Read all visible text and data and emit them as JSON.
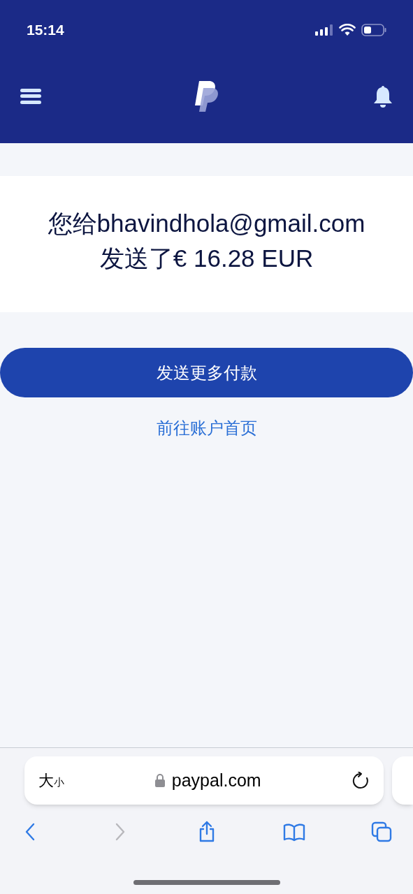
{
  "status_bar": {
    "time": "15:14"
  },
  "confirmation": {
    "lines": [
      "您给bhavindhola@gmail.com",
      "发送了€ 16.28 EUR"
    ]
  },
  "primary_button": "发送更多付款",
  "link": "前往账户首页",
  "browser": {
    "text_size": {
      "big": "大",
      "small": "小"
    },
    "url": "paypal.com",
    "toolbar": [
      {
        "kind": "back",
        "disabled": false
      },
      {
        "kind": "forward",
        "disabled": true
      },
      {
        "kind": "share",
        "disabled": false
      },
      {
        "kind": "bookmarks",
        "disabled": false
      },
      {
        "kind": "tabs",
        "disabled": false
      }
    ]
  }
}
